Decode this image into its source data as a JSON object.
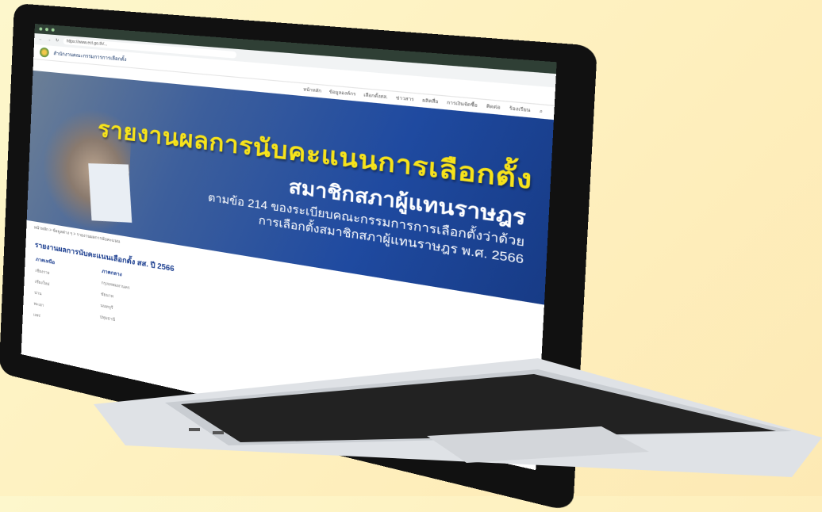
{
  "browser": {
    "url": "https://www.ect.go.th/..."
  },
  "site": {
    "name": "สำนักงานคณะกรรมการการเลือกตั้ง",
    "nav": [
      "หน้าหลัก",
      "ข้อมูลองค์กร",
      "เลือกตั้งสส.",
      "ข่าวสาร",
      "ผลิตสื่อ",
      "การเงินจัดซื้อ",
      "ติดต่อ",
      "ร้องเรียน"
    ]
  },
  "hero": {
    "title": "รายงานผลการนับคะแนนการเลือกตั้ง",
    "subtitle": "สมาชิกสภาผู้แทนราษฎร",
    "desc1": "ตามข้อ 214 ของระเบียบคณะกรรมการการเลือกตั้งว่าด้วย",
    "desc2": "การเลือกตั้งสมาชิกสภาผู้แทนราษฎร พ.ศ. 2566"
  },
  "breadcrumb": "หน้าหลัก > ข้อมูลต่าง ๆ > รายงานผลการนับคะแนน",
  "section": {
    "title": "รายงานผลการนับคะแนนเลือกตั้ง สส. ปี 2566"
  },
  "regions": [
    {
      "name": "ภาคเหนือ",
      "provinces": [
        "เชียงราย",
        "เชียงใหม่",
        "น่าน",
        "พะเยา",
        "แพร่"
      ]
    },
    {
      "name": "ภาคกลาง",
      "provinces": [
        "กรุงเทพมหานคร",
        "ชัยนาท",
        "นนทบุรี",
        "ปทุมธานี"
      ]
    }
  ],
  "colors": {
    "accent": "#1a3d8f",
    "hero_title": "#f7e31b",
    "bar": "#2f3f35"
  }
}
